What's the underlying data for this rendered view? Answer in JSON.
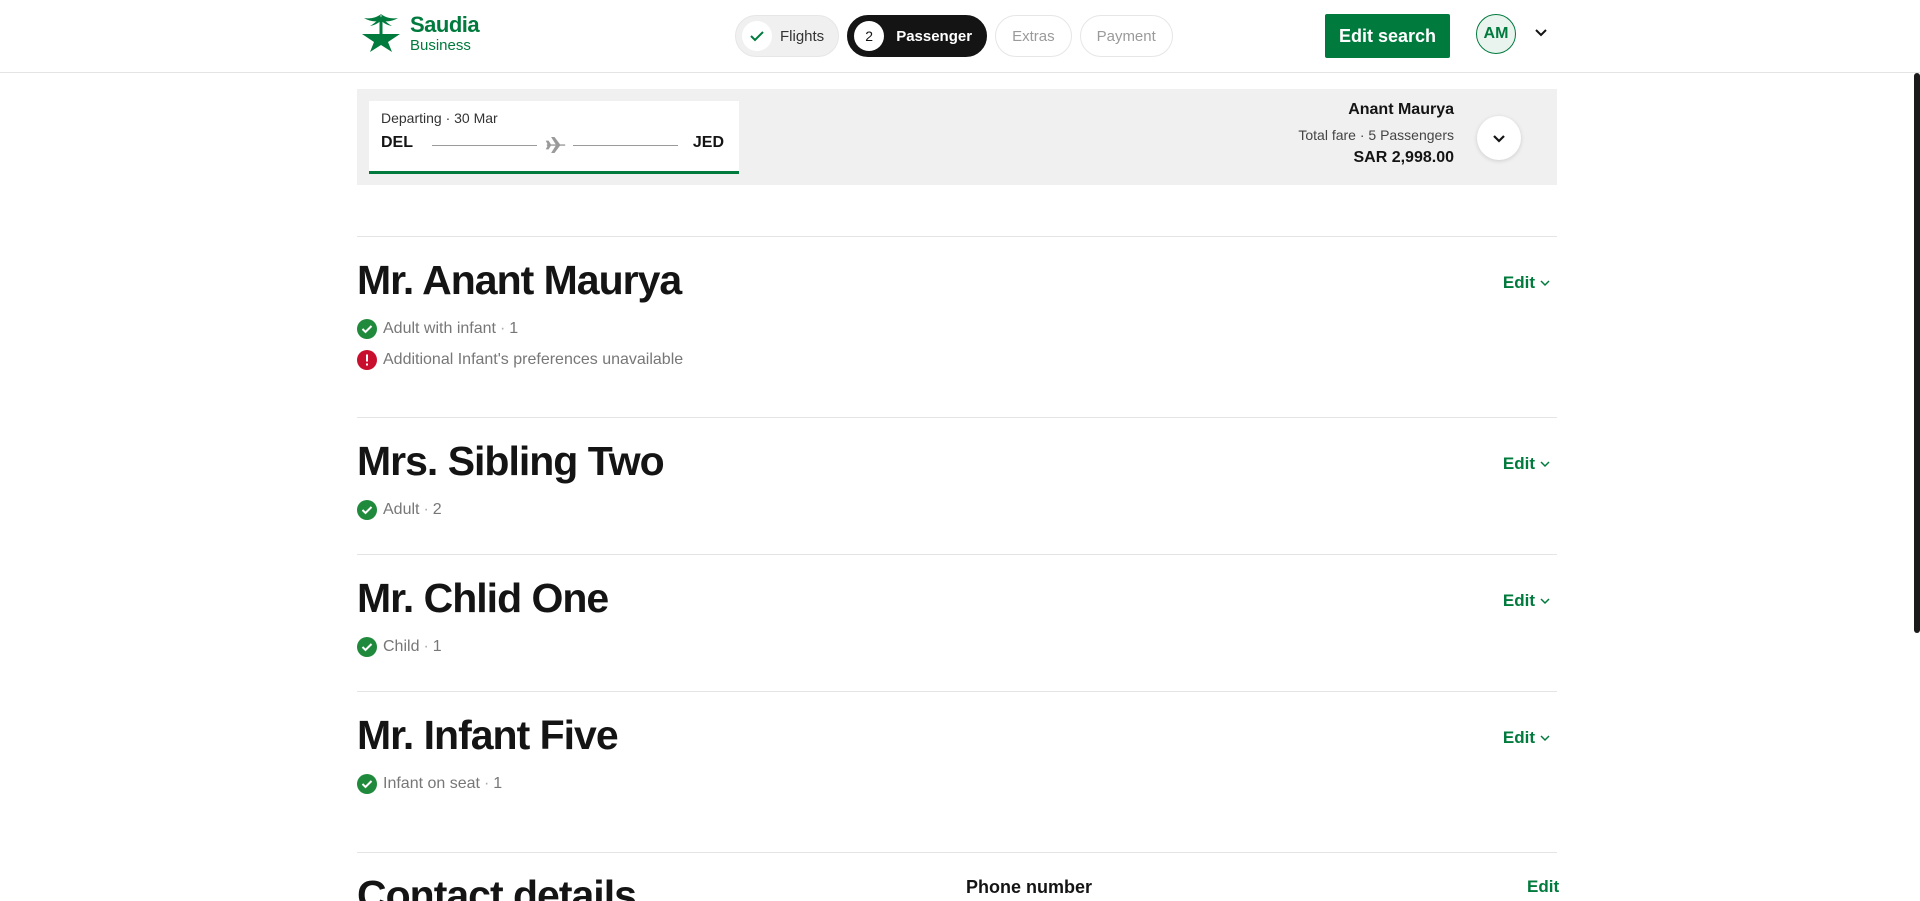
{
  "header": {
    "logo": {
      "name": "Saudia",
      "sub": "Business"
    },
    "steps": [
      {
        "label": "Flights",
        "state": "done",
        "marker": ""
      },
      {
        "label": "Passenger",
        "state": "active",
        "marker": "2"
      },
      {
        "label": "Extras",
        "state": "pending",
        "marker": ""
      },
      {
        "label": "Payment",
        "state": "pending",
        "marker": ""
      }
    ],
    "edit_search_label": "Edit search",
    "avatar_initials": "AM"
  },
  "summary": {
    "flight": {
      "date": "Departing · 30 Mar",
      "from": "DEL",
      "to": "JED"
    },
    "passenger_name": "Anant Maurya",
    "fare_label": "Total fare · 5 Passengers",
    "fare_amount": "SAR 2,998.00"
  },
  "passengers": [
    {
      "title": "Mr. Anant Maurya",
      "statuses": [
        {
          "type": "ok",
          "text": "Adult with infant",
          "index": "1"
        },
        {
          "type": "error",
          "text": "Additional Infant's preferences unavailable",
          "index": ""
        }
      ],
      "edit_label": "Edit"
    },
    {
      "title": "Mrs. Sibling Two",
      "statuses": [
        {
          "type": "ok",
          "text": "Adult",
          "index": "2"
        }
      ],
      "edit_label": "Edit"
    },
    {
      "title": "Mr. Chlid One",
      "statuses": [
        {
          "type": "ok",
          "text": "Child",
          "index": "1"
        }
      ],
      "edit_label": "Edit"
    },
    {
      "title": "Mr. Infant Five",
      "statuses": [
        {
          "type": "ok",
          "text": "Infant on seat",
          "index": "1"
        }
      ],
      "edit_label": "Edit"
    }
  ],
  "contact": {
    "title": "Contact details",
    "phone_label": "Phone number",
    "edit_label": "Edit"
  },
  "colors": {
    "brand": "#007a3d",
    "error": "#c8102e",
    "ok": "#1f8a3b"
  }
}
